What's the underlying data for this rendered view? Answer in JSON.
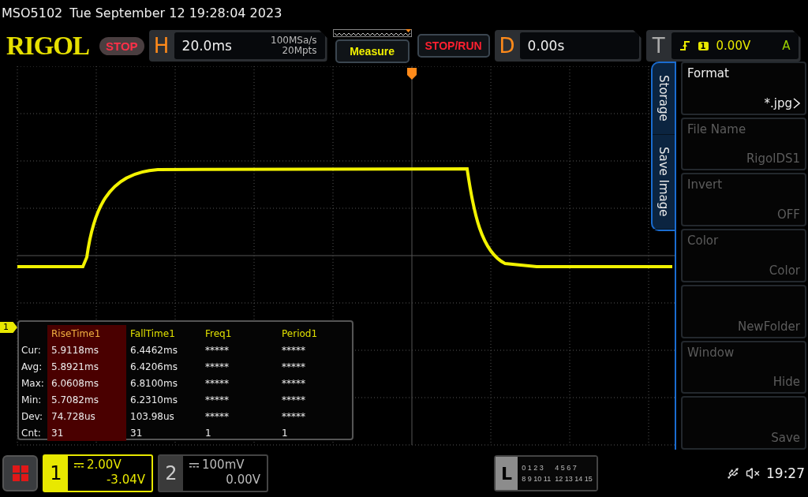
{
  "status_bar": {
    "model": "MSO5102",
    "datetime": "Tue September 12 19:28:04 2023"
  },
  "header": {
    "logo": "RIGOL",
    "run_state": "STOP",
    "horizontal": {
      "label": "H",
      "timebase": "20.0ms",
      "sample_rate": "100MSa/s",
      "memory_depth": "20Mpts"
    },
    "measure_button": "Measure",
    "stop_run_button": "STOP/RUN",
    "delay": {
      "label": "D",
      "value": "0.00s"
    },
    "trigger": {
      "label": "T",
      "source": "1",
      "level": "0.00V",
      "mode": "A"
    }
  },
  "channel_marker": "1",
  "measurements": {
    "columns": [
      {
        "label": "RiseTime1",
        "selected": true
      },
      {
        "label": "FallTime1",
        "selected": false
      },
      {
        "label": "Freq1",
        "selected": false
      },
      {
        "label": "Period1",
        "selected": false
      }
    ],
    "rows": [
      {
        "label": "Cur:",
        "values": [
          "5.9118ms",
          "6.4462ms",
          "*****",
          "*****"
        ]
      },
      {
        "label": "Avg:",
        "values": [
          "5.8921ms",
          "6.4206ms",
          "*****",
          "*****"
        ]
      },
      {
        "label": "Max:",
        "values": [
          "6.0608ms",
          "6.8100ms",
          "*****",
          "*****"
        ]
      },
      {
        "label": "Min:",
        "values": [
          "5.7082ms",
          "6.2310ms",
          "*****",
          "*****"
        ]
      },
      {
        "label": "Dev:",
        "values": [
          "74.728us",
          "103.98us",
          "*****",
          "*****"
        ]
      },
      {
        "label": "Cnt:",
        "values": [
          "31",
          "31",
          "1",
          "1"
        ]
      }
    ]
  },
  "side_menu": {
    "tabs": [
      "Storage",
      "Save Image"
    ],
    "items": [
      {
        "label": "Format",
        "value": "*.jpg",
        "disabled": false,
        "submenu": true
      },
      {
        "label": "File Name",
        "value": "RigolDS1",
        "disabled": true,
        "submenu": false
      },
      {
        "label": "Invert",
        "value": "OFF",
        "disabled": true,
        "submenu": false
      },
      {
        "label": "Color",
        "value": "Color",
        "disabled": true,
        "submenu": false
      },
      {
        "value": "NewFolder",
        "disabled": true,
        "submenu": false
      },
      {
        "label": "Window",
        "value": "Hide",
        "disabled": true,
        "submenu": false
      },
      {
        "value": "Save",
        "disabled": true,
        "submenu": false
      }
    ]
  },
  "channels": [
    {
      "number": "1",
      "scale": "2.00V",
      "offset": "-3.04V",
      "on": true
    },
    {
      "number": "2",
      "scale": "100mV",
      "offset": "0.00V",
      "on": false
    }
  ],
  "logic": {
    "label": "L",
    "groups": [
      [
        "0",
        "1",
        "2",
        "3"
      ],
      [
        "4",
        "5",
        "6",
        "7"
      ],
      [
        "8",
        "9",
        "10",
        "11"
      ],
      [
        "12",
        "13",
        "14",
        "15"
      ]
    ]
  },
  "clock": "19:27"
}
